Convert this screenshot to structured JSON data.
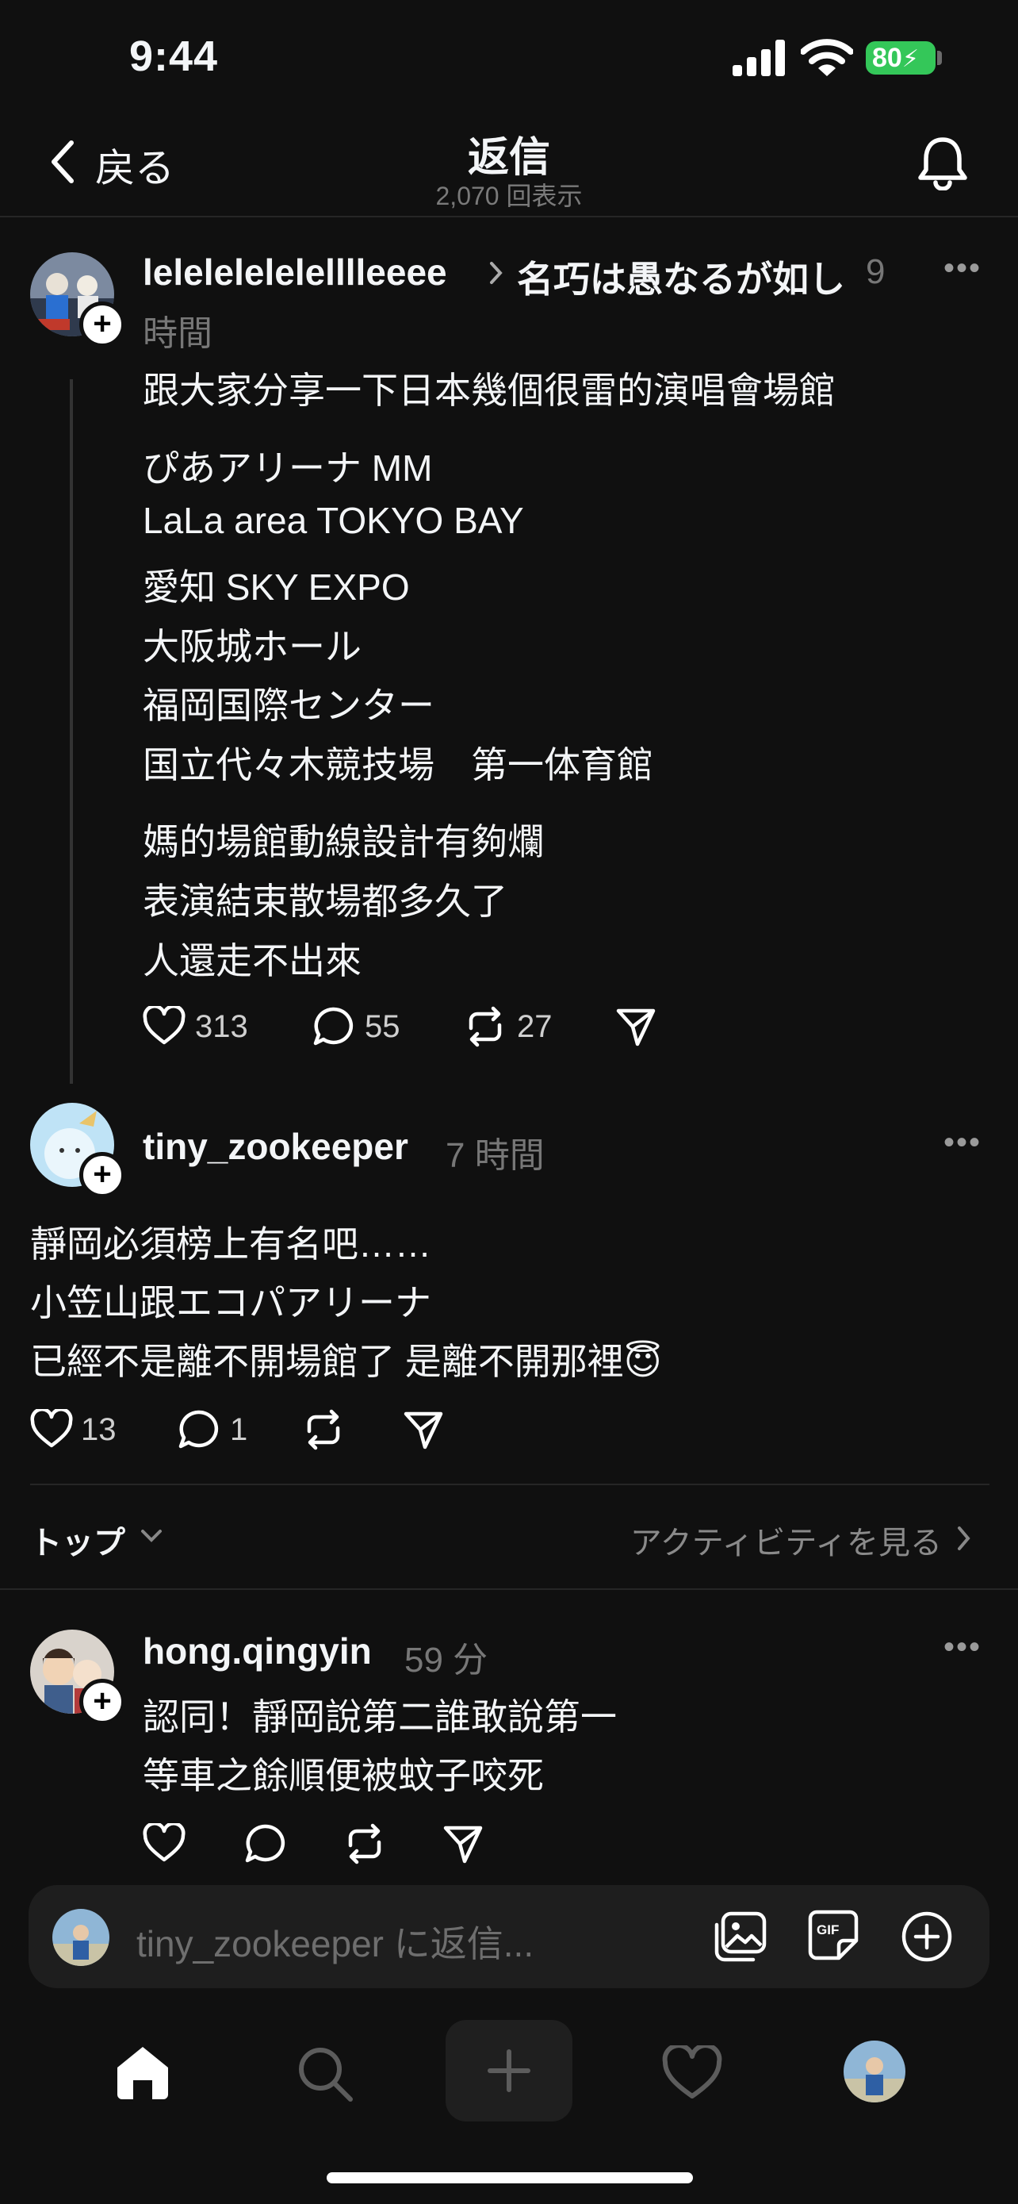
{
  "status": {
    "time": "9:44",
    "battery": "80"
  },
  "header": {
    "back_label": "戻る",
    "title": "返信",
    "subtitle": "2,070 回表示"
  },
  "original_post": {
    "username": "lelelelelelelllleeee",
    "separator": "›",
    "topic": "名巧は愚なるが如し",
    "time_part1": "9",
    "time_part2": "時間",
    "lines_block1": [
      "跟大家分享一下日本幾個很雷的演唱會場館"
    ],
    "lines_block2": [
      "ぴあアリーナ MM",
      "LaLa area TOKYO BAY",
      "愛知 SKY EXPO",
      "大阪城ホール",
      "福岡国際センター",
      "国立代々木競技場　第一体育館"
    ],
    "lines_block3": [
      "媽的場館動線設計有夠爛",
      "表演結束散場都多久了",
      "人還走不出來"
    ],
    "likes": "313",
    "comments": "55",
    "reposts": "27"
  },
  "reply_post": {
    "username": "tiny_zookeeper",
    "time": "7 時間",
    "lines": [
      "靜岡必須榜上有名吧……",
      "小笠山跟エコパアリーナ",
      "已經不是離不開場館了 是離不開那裡"
    ],
    "emoji": "😇",
    "likes": "13",
    "comments": "1"
  },
  "sort": {
    "label": "トップ",
    "activity_link": "アクティビティを見る"
  },
  "comment": {
    "username": "hong.qingyin",
    "time": "59 分",
    "lines": [
      "認同！靜岡說第二誰敢說第一",
      "等車之餘順便被蚊子咬死"
    ]
  },
  "reply_input": {
    "placeholder": "tiny_zookeeper に返信..."
  },
  "icons": {
    "more": "more-icon",
    "like": "heart-icon",
    "comment": "comment-icon",
    "repost": "repost-icon",
    "share": "send-icon",
    "bell": "bell-icon",
    "gallery": "gallery-icon",
    "gif": "gif-icon",
    "add": "add-icon",
    "home": "home-icon",
    "search": "search-icon",
    "compose": "compose-icon",
    "activity": "heart-icon",
    "profile": "avatar"
  },
  "colors": {
    "background": "#101010",
    "battery": "#34c759",
    "text": "#f3f5f7",
    "muted": "#777777"
  }
}
